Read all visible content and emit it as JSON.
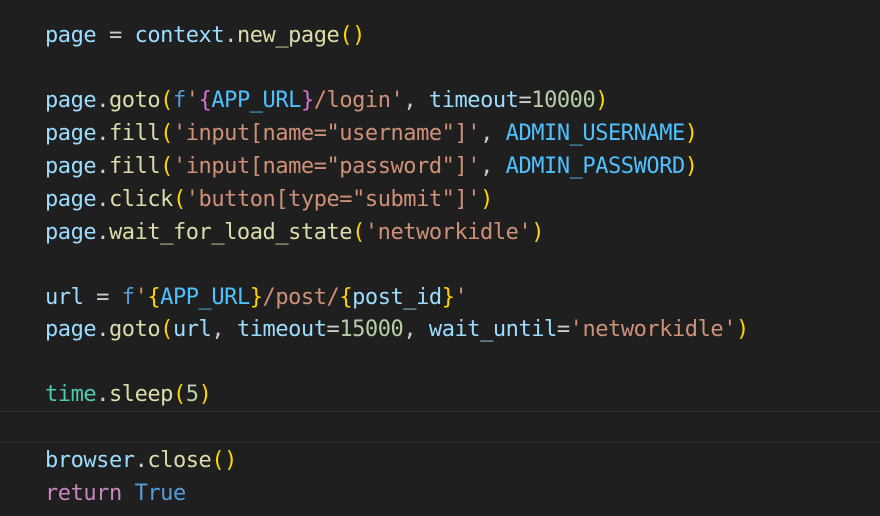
{
  "editor": {
    "lines": {
      "l1": {
        "obj": "page",
        "eq": " = ",
        "ctx": "context",
        "dot": ".",
        "fn": "new_page",
        "open": "(",
        "close": ")"
      },
      "l3": {
        "obj": "page",
        "dot": ".",
        "fn": "goto",
        "open": "(",
        "fprefix": "f",
        "q1": "'",
        "ob": "{",
        "var": "APP_URL",
        "cb": "}",
        "path": "/login",
        "q2": "'",
        "sep": ", ",
        "param": "timeout",
        "eq": "=",
        "num": "10000",
        "close": ")"
      },
      "l4": {
        "obj": "page",
        "dot": ".",
        "fn": "fill",
        "open": "(",
        "str": "'input[name=\"username\"]'",
        "sep": ", ",
        "const": "ADMIN_USERNAME",
        "close": ")"
      },
      "l5": {
        "obj": "page",
        "dot": ".",
        "fn": "fill",
        "open": "(",
        "str": "'input[name=\"password\"]'",
        "sep": ", ",
        "const": "ADMIN_PASSWORD",
        "close": ")"
      },
      "l6": {
        "obj": "page",
        "dot": ".",
        "fn": "click",
        "open": "(",
        "str": "'button[type=\"submit\"]'",
        "close": ")"
      },
      "l7": {
        "obj": "page",
        "dot": ".",
        "fn": "wait_for_load_state",
        "open": "(",
        "str": "'networkidle'",
        "close": ")"
      },
      "l9": {
        "obj": "url",
        "eq": " = ",
        "fprefix": "f",
        "q1": "'",
        "ob1": "{",
        "var1": "APP_URL",
        "cb1": "}",
        "path": "/post/",
        "ob2": "{",
        "var2": "post_id",
        "cb2": "}",
        "q2": "'"
      },
      "l10": {
        "obj": "page",
        "dot": ".",
        "fn": "goto",
        "open": "(",
        "arg": "url",
        "sep1": ", ",
        "param1": "timeout",
        "eq1": "=",
        "num": "15000",
        "sep2": ", ",
        "param2": "wait_until",
        "eq2": "=",
        "str": "'networkidle'",
        "close": ")"
      },
      "l12": {
        "mod": "time",
        "dot": ".",
        "fn": "sleep",
        "open": "(",
        "num": "5",
        "close": ")"
      },
      "l14": {
        "obj": "browser",
        "dot": ".",
        "fn": "close",
        "open": "(",
        "close": ")"
      },
      "l15": {
        "kw": "return",
        "sp": " ",
        "val": "True"
      }
    }
  }
}
